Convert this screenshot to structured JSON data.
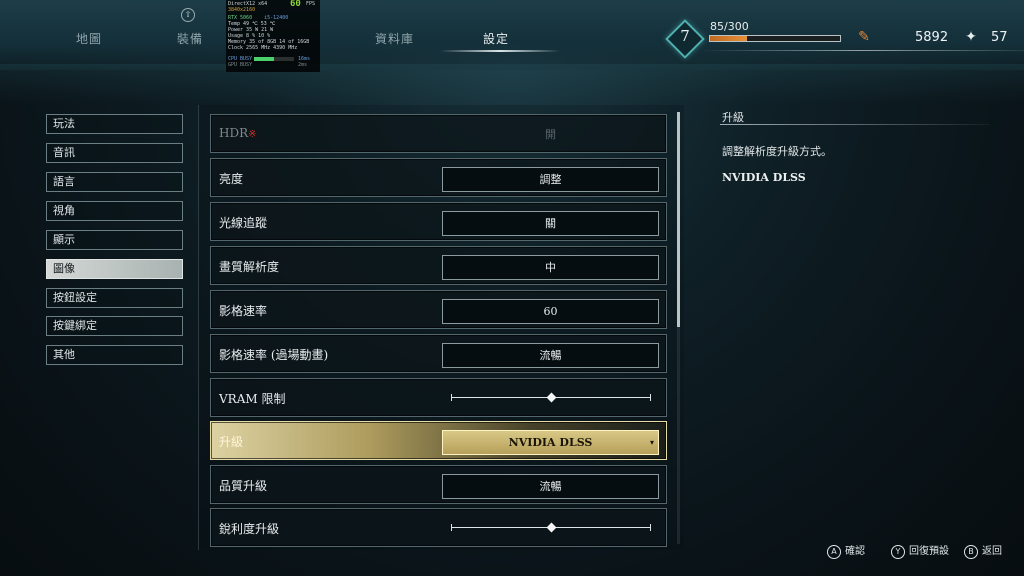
{
  "nav": {
    "tabs": [
      {
        "label": "地圖"
      },
      {
        "label": "裝備"
      },
      {
        "label": "資料庫"
      },
      {
        "label": "設定"
      }
    ],
    "hint_icon": "⇧"
  },
  "overlay": {
    "api": "DirectX12 x64",
    "resolution": "3840x2160",
    "fps": "60",
    "fps_unit": "FPS",
    "gpu": "RTX 5060",
    "cpu": "i5-12400",
    "lines": [
      "Temp     49 ℃      53 ℃",
      "Power    35 W      21 W",
      "Usage     8 %      10 %",
      "Memory   35 of 8GB  14 of 16GB",
      "Clock  2565 MHz  4390 MHz"
    ],
    "cpu_busy_label": "CPU BUSY",
    "cpu_busy_value": "16ms",
    "gpu_busy_label": "GPU BUSY",
    "gpu_busy_value": "2ms",
    "cpu_busy_fraction": 0.5
  },
  "hud": {
    "level": "7",
    "xp_text": "85/300",
    "xp_fraction": 0.283,
    "gold": "5892",
    "items": "57",
    "gold_icon": "feather-icon",
    "items_icon": "sparkle-icon",
    "accent": "#e6913a"
  },
  "sidebar": {
    "items": [
      {
        "label": "玩法"
      },
      {
        "label": "音訊"
      },
      {
        "label": "語言"
      },
      {
        "label": "視角"
      },
      {
        "label": "顯示"
      },
      {
        "label": "圖像"
      },
      {
        "label": "按鈕設定"
      },
      {
        "label": "按鍵綁定"
      },
      {
        "label": "其他"
      }
    ],
    "active_index": 5
  },
  "settings": {
    "rows": [
      {
        "label": "HDR",
        "required_mark": "※",
        "value": "開",
        "disabled": true
      },
      {
        "label": "亮度",
        "value": "調整"
      },
      {
        "label": "光線追蹤",
        "value": "關"
      },
      {
        "label": "畫質解析度",
        "value": "中"
      },
      {
        "label": "影格速率",
        "value": "60"
      },
      {
        "label": "影格速率 (過場動畫)",
        "value": "流暢"
      },
      {
        "label": "VRAM 限制",
        "slider_fraction": 0.5
      },
      {
        "label": "升級",
        "value": "NVIDIA DLSS",
        "dropdown_glyph": "▾"
      },
      {
        "label": "品質升級",
        "value": "流暢"
      },
      {
        "label": "銳利度升級",
        "slider_fraction": 0.5
      }
    ],
    "selected_index": 7,
    "scroll_fraction": 0.5
  },
  "description": {
    "title": "升級",
    "body": "調整解析度升級方式。",
    "current_value": "NVIDIA DLSS"
  },
  "footer": {
    "hints": [
      {
        "button": "A",
        "label": "確認"
      },
      {
        "button": "Y",
        "label": "回復預設"
      },
      {
        "button": "B",
        "label": "返回"
      }
    ]
  }
}
